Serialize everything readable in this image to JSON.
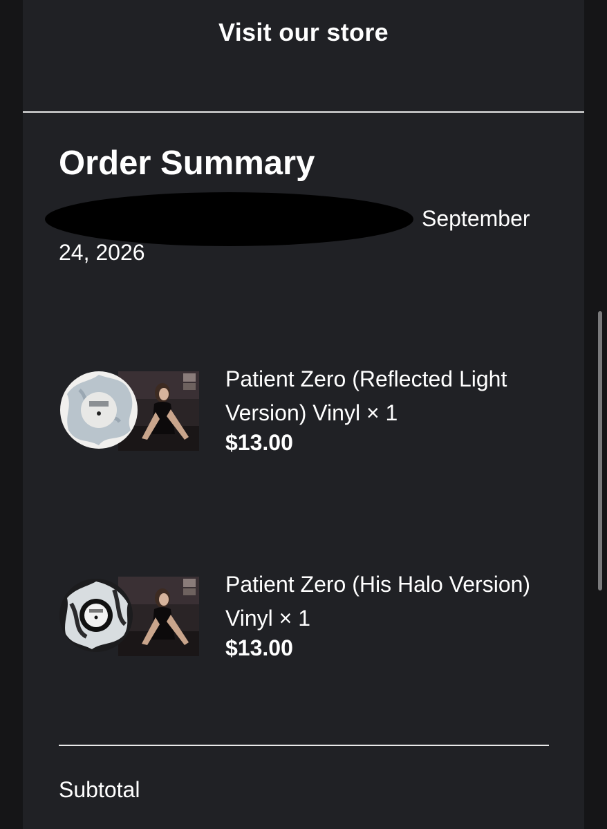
{
  "header": {
    "store_link": "Visit our store"
  },
  "order": {
    "title": "Order Summary",
    "date_line1": "September",
    "date_line2": "24, 2026"
  },
  "items": [
    {
      "name": "Patient Zero (Reflected Light Version) Vinyl × 1",
      "price": "$13.00",
      "vinyl_color": "#b9c4cc"
    },
    {
      "name": "Patient Zero (His Halo Version) Vinyl × 1",
      "price": "$13.00",
      "vinyl_color": "#1c1c1e"
    }
  ],
  "summary": {
    "subtotal_label": "Subtotal"
  },
  "colors": {
    "background": "#202125",
    "text": "#ffffff",
    "divider": "#e9e9e9"
  }
}
